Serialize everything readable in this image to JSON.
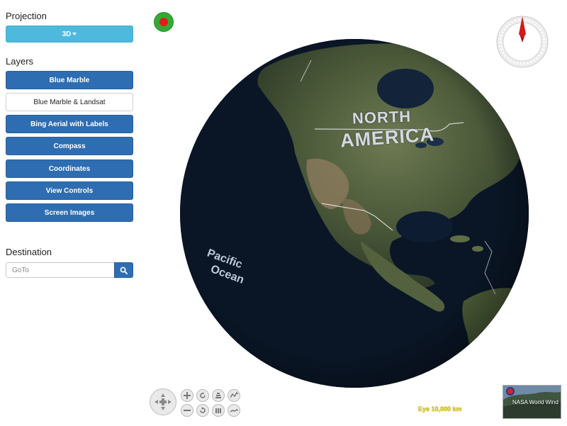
{
  "sidebar": {
    "projection_title": "Projection",
    "projection_value": "3D",
    "layers_title": "Layers",
    "layers": [
      {
        "label": "Blue Marble",
        "active": false
      },
      {
        "label": "Blue Marble & Landsat",
        "active": true
      },
      {
        "label": "Bing Aerial with Labels",
        "active": false
      },
      {
        "label": "Compass",
        "active": false
      },
      {
        "label": "Coordinates",
        "active": false
      },
      {
        "label": "View Controls",
        "active": false
      },
      {
        "label": "Screen Images",
        "active": false
      }
    ],
    "destination_title": "Destination",
    "goto_placeholder": "GoTo"
  },
  "globe": {
    "labels": {
      "north": "NORTH",
      "america": "AMERICA",
      "pacific": "Pacific",
      "ocean": "Ocean"
    }
  },
  "status": {
    "eye_text": "Eye  10,000 km"
  },
  "logo": {
    "text": "NASA World Wind"
  },
  "icons": [
    "crosshair-icon",
    "compass-icon",
    "pan-control-icon",
    "zoom-in-icon",
    "zoom-out-icon",
    "rotate-icon",
    "rotate-reset-icon",
    "tilt-up-icon",
    "tilt-down-icon",
    "exaggeration-up-icon",
    "exaggeration-down-icon",
    "search-icon"
  ],
  "colors": {
    "primary_button": "#2e6db1",
    "projection_button": "#4cb9dd",
    "eye_text": "#e8d21a"
  }
}
